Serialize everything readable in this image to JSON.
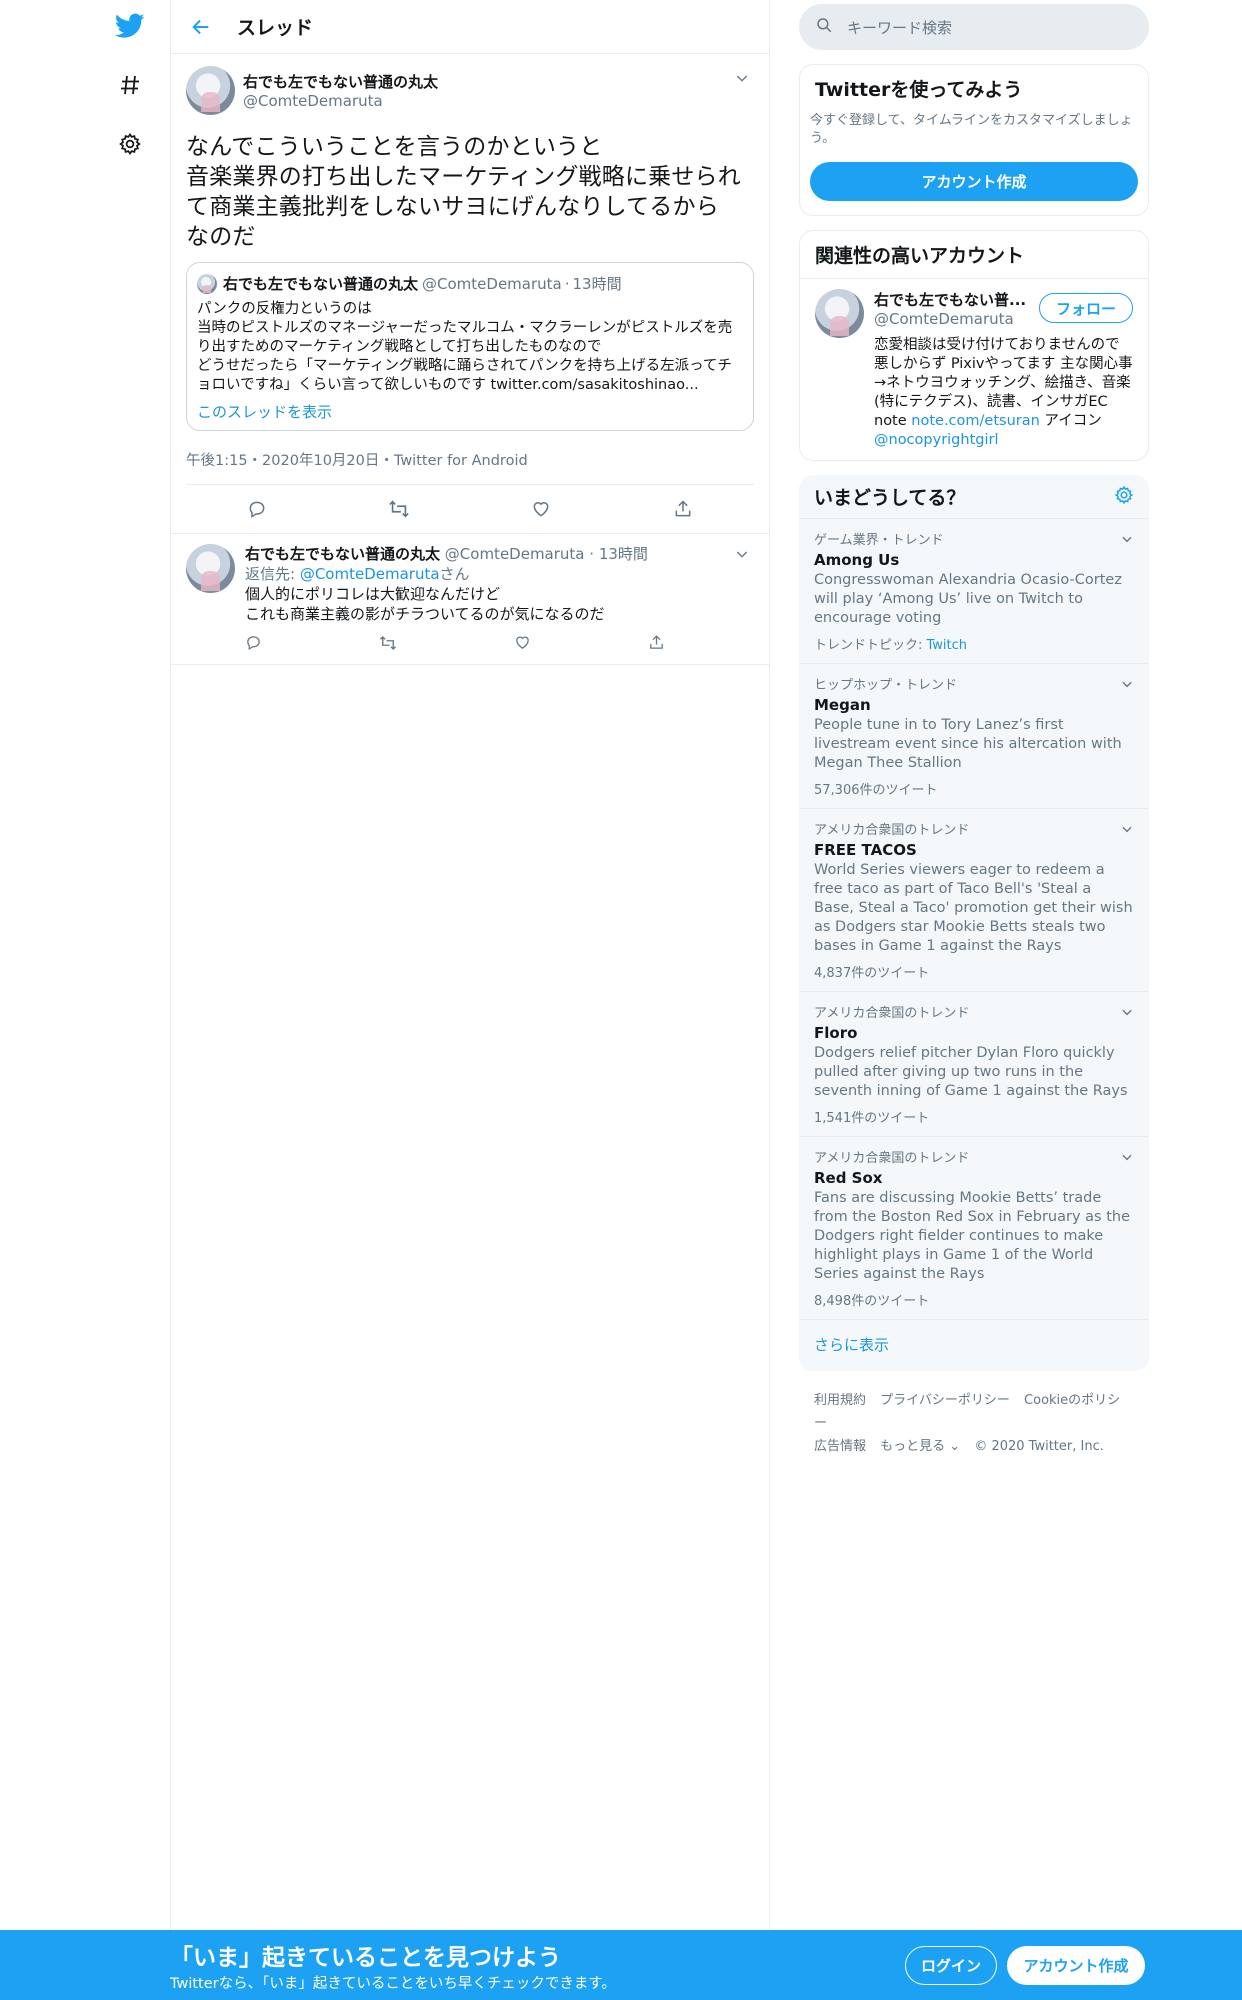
{
  "colors": {
    "accent": "#1da1f2",
    "link": "#1b95e0",
    "muted": "#657786",
    "border": "#e6ecf0"
  },
  "nav": {
    "icons": [
      "twitter-logo",
      "hashtag-icon",
      "gear-icon"
    ]
  },
  "header": {
    "title": "スレッド"
  },
  "tweet": {
    "name": "右でも左でもない普通の丸太",
    "handle": "@ComteDemaruta",
    "text": "なんでこういうことを言うのかというと\n音楽業界の打ち出したマーケティング戦略に乗せられて商業主義批判をしないサヨにげんなりしてるから\nなのだ",
    "quote": {
      "name": "右でも左でもない普通の丸太",
      "handle": "@ComteDemaruta",
      "time": "13時間",
      "text": "パンクの反権力というのは\n当時のピストルズのマネージャーだったマルコム・マクラーレンがピストルズを売り出すためのマーケティング戦略として打ち出したものなので\nどうせだったら「マーケティング戦略に踊らされてパンクを持ち上げる左派ってチョロいですね」くらい言って欲しいものです twitter.com/sasakitoshinao...",
      "show_thread": "このスレッドを表示"
    },
    "meta": "午後1:15・2020年10月20日・Twitter for Android"
  },
  "reply": {
    "name": "右でも左でもない普通の丸太",
    "handle": "@ComteDemaruta",
    "time": "13時間",
    "reply_to_label": "返信先: ",
    "reply_to_handle": "@ComteDemaruta",
    "reply_to_suffix": "さん",
    "text": "個人的にポリコレは大歓迎なんだけど\nこれも商業主義の影がチラついてるのが気になるのだ"
  },
  "sidebar": {
    "search_placeholder": "キーワード検索",
    "signup": {
      "title": "Twitterを使ってみよう",
      "desc": "今すぐ登録して、タイムラインをカスタマイズしましょう。",
      "button": "アカウント作成"
    },
    "related": {
      "title": "関連性の高いアカウント",
      "name": "右でも左でもない普...",
      "handle": "@ComteDemaruta",
      "follow": "フォロー",
      "bio_before": "恋愛相談は受け付けておりませんので悪しからず Pixivやってます 主な関心事→ネトウヨウォッチング、絵描き、音楽(特にテクデス)、読書、インサガEC note ",
      "bio_link1": "note.com/etsuran",
      "bio_mid": " アイコン ",
      "bio_link2": "@nocopyrightgirl"
    },
    "trends": {
      "title": "いまどうしてる？",
      "items": [
        {
          "context": "ゲーム業界・トレンド",
          "name": "Among Us",
          "desc": "Congresswoman Alexandria Ocasio-Cortez will play ‘Among Us’ live on Twitch to encourage voting",
          "count": "",
          "topic_label": "トレンドトピック: ",
          "topic": "Twitch"
        },
        {
          "context": "ヒップホップ・トレンド",
          "name": "Megan",
          "desc": "People tune in to Tory Lanez’s first livestream event since his altercation with Megan Thee Stallion",
          "count": "57,306件のツイート"
        },
        {
          "context": "アメリカ合衆国のトレンド",
          "name": "FREE TACOS",
          "desc": "World Series viewers eager to redeem a free taco as part of Taco Bell's 'Steal a Base, Steal a Taco' promotion get their wish as Dodgers star Mookie Betts steals two bases in Game 1 against the Rays",
          "count": "4,837件のツイート"
        },
        {
          "context": "アメリカ合衆国のトレンド",
          "name": "Floro",
          "desc": "Dodgers relief pitcher Dylan Floro quickly pulled after giving up two runs in the seventh inning of Game 1 against the Rays",
          "count": "1,541件のツイート"
        },
        {
          "context": "アメリカ合衆国のトレンド",
          "name": "Red Sox",
          "desc": "Fans are discussing Mookie Betts’ trade from the Boston Red Sox in February as the Dodgers right fielder continues to make highlight plays in Game 1 of the World Series against the Rays",
          "count": "8,498件のツイート"
        }
      ],
      "more": "さらに表示"
    },
    "footer": {
      "terms": "利用規約",
      "privacy": "プライバシーポリシー",
      "cookie": "Cookieのポリシー",
      "ads": "広告情報",
      "more": "もっと見る ⌄",
      "copyright": "© 2020 Twitter, Inc."
    }
  },
  "banner": {
    "title": "「いま」起きていることを見つけよう",
    "subtitle": "Twitterなら、「いま」起きていることをいち早くチェックできます。",
    "login": "ログイン",
    "signup": "アカウント作成"
  }
}
